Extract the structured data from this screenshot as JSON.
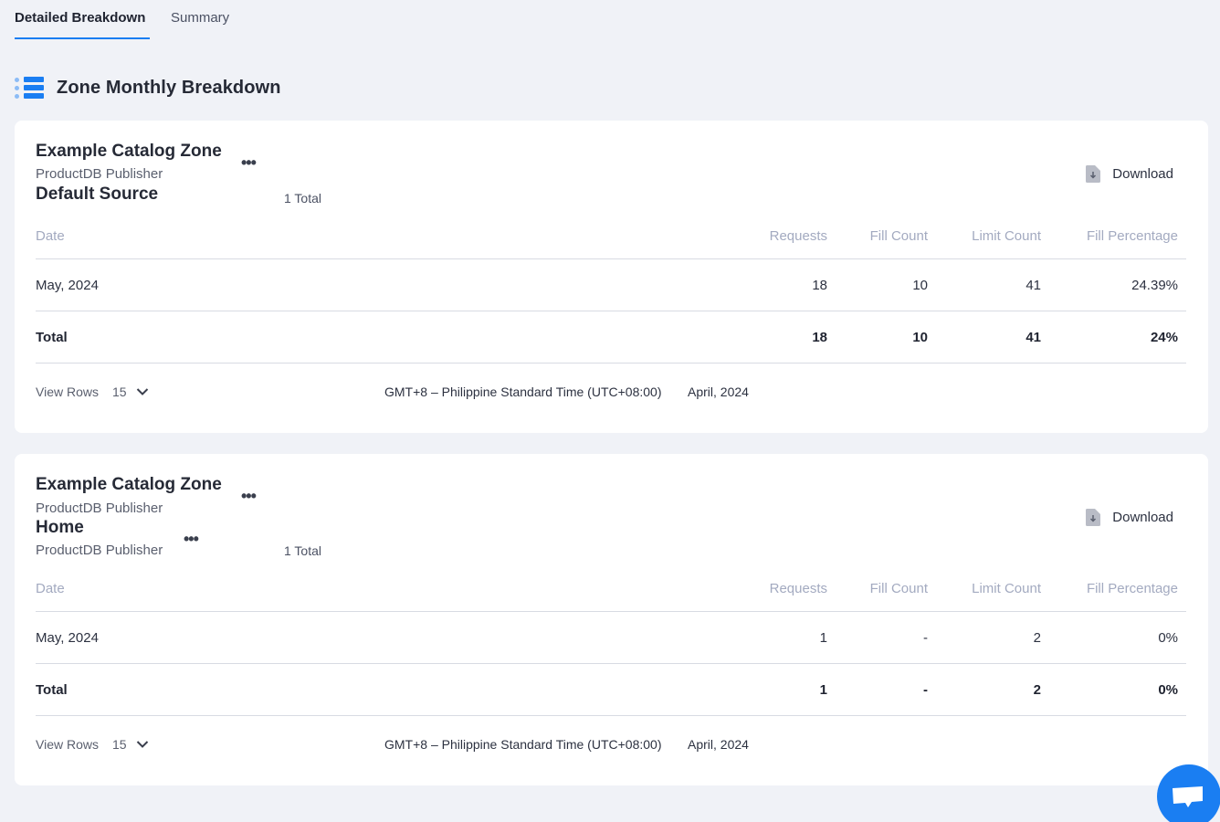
{
  "tabs": [
    {
      "label": "Detailed Breakdown",
      "active": true
    },
    {
      "label": "Summary",
      "active": false
    }
  ],
  "section": {
    "title": "Zone Monthly Breakdown",
    "icon": "list-icon"
  },
  "colors": {
    "accent": "#1a7ef2",
    "background": "#f0f2f7",
    "header_text": "#a3aac0"
  },
  "columns": [
    "Date",
    "Requests",
    "Fill Count",
    "Limit Count",
    "Fill Percentage"
  ],
  "cards": [
    {
      "zone_name": "Example Catalog Zone",
      "zone_publisher": "ProductDB Publisher",
      "source_name": "Default Source",
      "source_publisher": null,
      "total_count": "1 Total",
      "download_label": "Download",
      "rows": [
        {
          "date": "May, 2024",
          "requests": "18",
          "fill_count": "10",
          "limit_count": "41",
          "fill_percentage": "24.39%"
        }
      ],
      "total": {
        "label": "Total",
        "requests": "18",
        "fill_count": "10",
        "limit_count": "41",
        "fill_percentage": "24%"
      },
      "footer": {
        "view_rows_label": "View Rows",
        "view_rows_value": "15",
        "timezone": "GMT+8 – Philippine Standard Time (UTC+08:00)",
        "month": "April, 2024"
      }
    },
    {
      "zone_name": "Example Catalog Zone",
      "zone_publisher": "ProductDB Publisher",
      "source_name": "Home",
      "source_publisher": "ProductDB Publisher",
      "total_count": "1 Total",
      "download_label": "Download",
      "rows": [
        {
          "date": "May, 2024",
          "requests": "1",
          "fill_count": "-",
          "limit_count": "2",
          "fill_percentage": "0%"
        }
      ],
      "total": {
        "label": "Total",
        "requests": "1",
        "fill_count": "-",
        "limit_count": "2",
        "fill_percentage": "0%"
      },
      "footer": {
        "view_rows_label": "View Rows",
        "view_rows_value": "15",
        "timezone": "GMT+8 – Philippine Standard Time (UTC+08:00)",
        "month": "April, 2024"
      }
    }
  ],
  "chat": {
    "icon": "chat-icon"
  }
}
